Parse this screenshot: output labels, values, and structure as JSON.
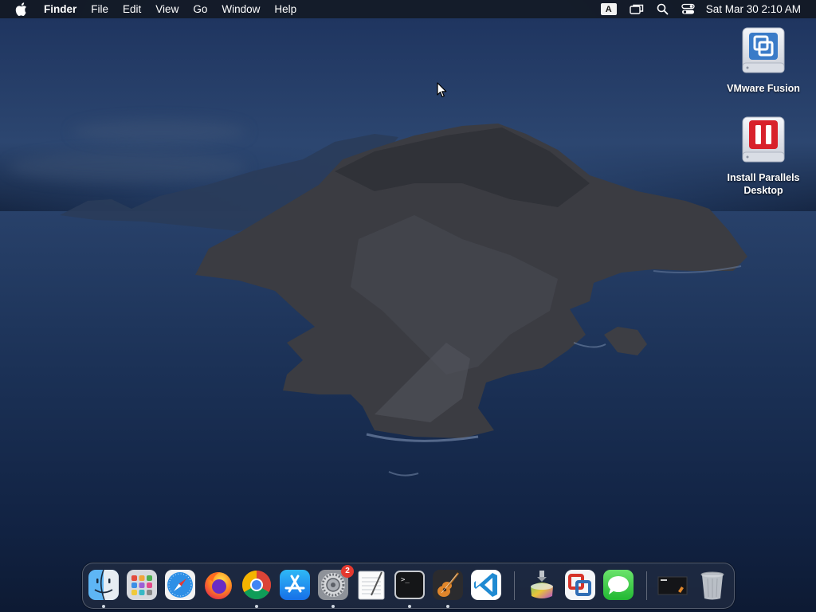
{
  "menubar": {
    "app_name": "Finder",
    "items": [
      "File",
      "Edit",
      "View",
      "Go",
      "Window",
      "Help"
    ],
    "input_source": "A",
    "clock": "Sat Mar 30  2:10 AM"
  },
  "desktop_icons": [
    {
      "label": "VMware Fusion",
      "icon": "vmware-fusion-disk-icon"
    },
    {
      "label": "Install Parallels Desktop",
      "icon": "parallels-installer-disk-icon"
    }
  ],
  "dock": {
    "apps": [
      {
        "name": "Finder",
        "icon": "finder-icon",
        "running": true
      },
      {
        "name": "Launchpad",
        "icon": "launchpad-icon",
        "running": false
      },
      {
        "name": "Safari",
        "icon": "safari-icon",
        "running": false
      },
      {
        "name": "Firefox",
        "icon": "firefox-icon",
        "running": false
      },
      {
        "name": "Google Chrome",
        "icon": "chrome-icon",
        "running": true
      },
      {
        "name": "App Store",
        "icon": "app-store-icon",
        "running": false
      },
      {
        "name": "System Settings",
        "icon": "system-settings-icon",
        "running": true,
        "badge": "2"
      },
      {
        "name": "TextEdit",
        "icon": "textedit-icon",
        "running": false
      },
      {
        "name": "Terminal",
        "icon": "terminal-icon",
        "running": true
      },
      {
        "name": "GarageBand",
        "icon": "garageband-icon",
        "running": true
      },
      {
        "name": "Visual Studio Code",
        "icon": "vscode-icon",
        "running": false
      },
      {
        "name": "Installer",
        "icon": "installer-icon",
        "running": false
      },
      {
        "name": "VMware Fusion",
        "icon": "vmware-fusion-icon",
        "running": false
      },
      {
        "name": "Messages",
        "icon": "messages-icon",
        "running": false
      },
      {
        "name": "Recent Document",
        "icon": "recent-document-icon",
        "running": false
      },
      {
        "name": "Trash",
        "icon": "trash-icon",
        "running": false
      }
    ],
    "terminal_prompt": ">_"
  },
  "colors": {
    "menubar_bg": "#141a26",
    "badge_red": "#e5392f",
    "parallels_red": "#d8212b",
    "vmware_blue": "#2f6db5"
  }
}
